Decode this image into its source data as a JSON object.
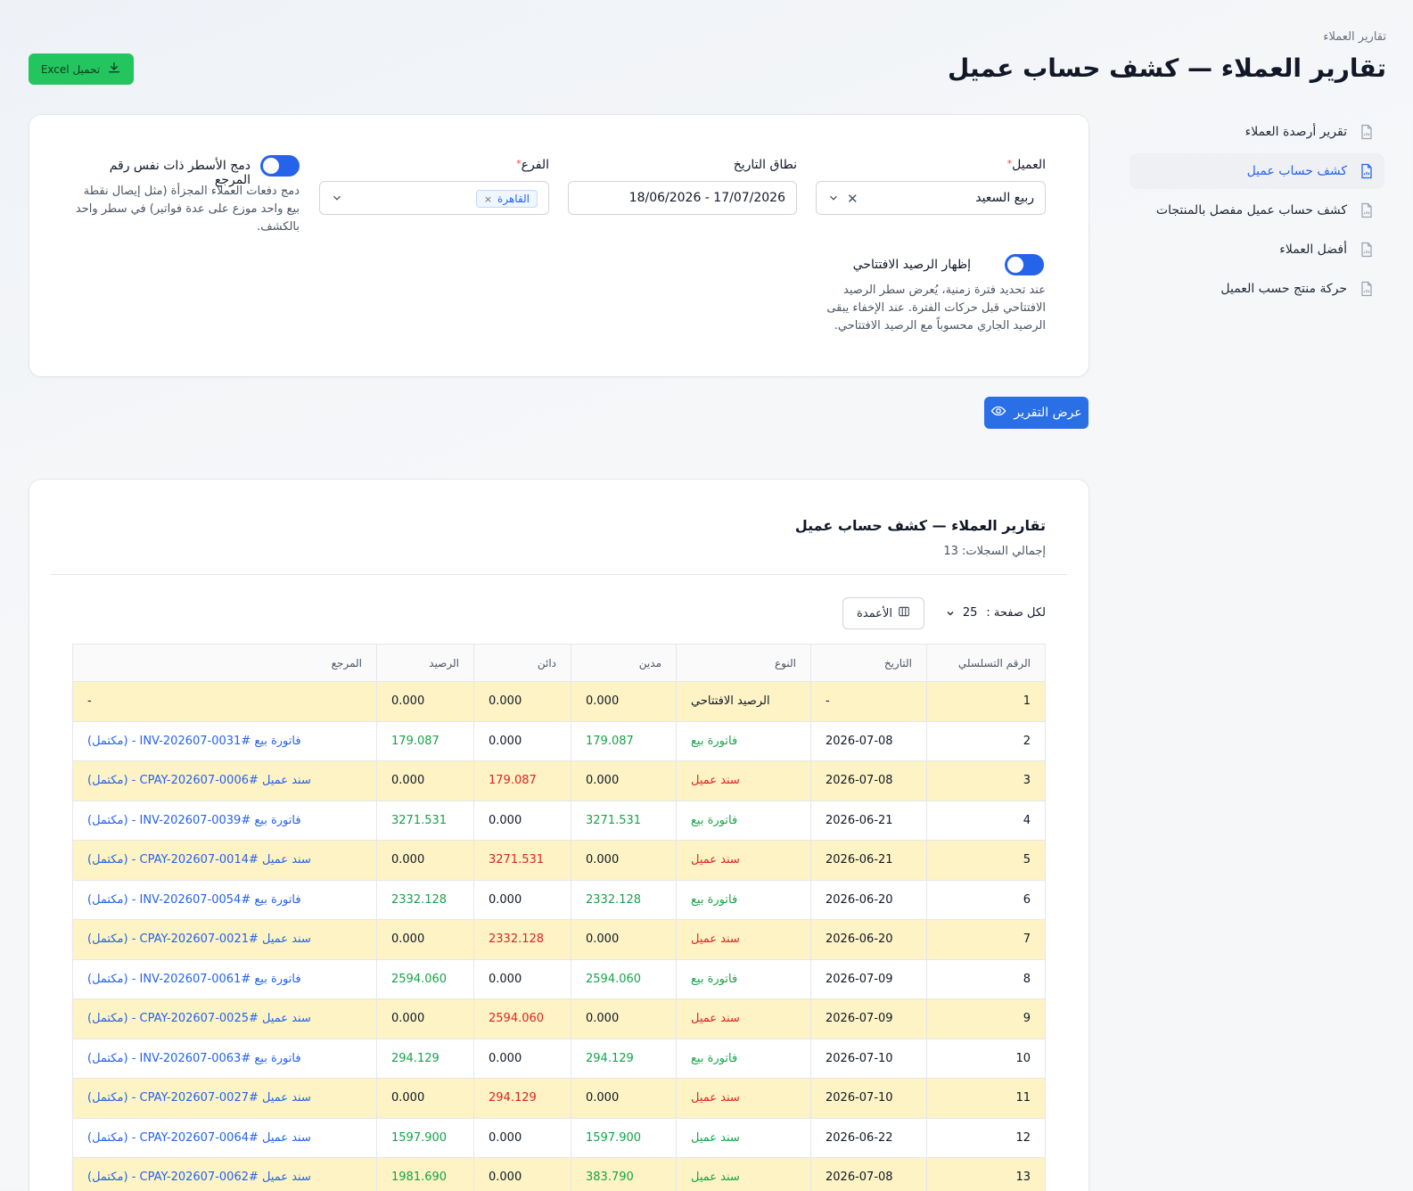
{
  "header": {
    "breadcrumb": "تقارير العملاء",
    "title": "تقارير العملاء — كشف حساب عميل",
    "excel_label": "تحميل Excel"
  },
  "sidebar": {
    "items": [
      {
        "label": "تقرير أرصدة العملاء",
        "active": false
      },
      {
        "label": "كشف حساب عميل",
        "active": true
      },
      {
        "label": "كشف حساب عميل مفصل بالمنتجات",
        "active": false
      },
      {
        "label": "أفضل العملاء",
        "active": false
      },
      {
        "label": "حركة منتج حسب العميل",
        "active": false
      }
    ]
  },
  "filters": {
    "customer_label": "العميل",
    "customer_value": "ربيع السعيد",
    "date_label": "نطاق التاريخ",
    "date_value": "18/06/2026 - 17/07/2026",
    "branch_label": "الفرع",
    "branch_tag": "القاهرة",
    "merge_label": "دمج الأسطر ذات نفس رقم المرجع",
    "merge_help": "دمج دفعات العملاء المجزأة (مثل إيصال نقطة بيع واحد موزع على عدة فواتير) في سطر واحد بالكشف.",
    "opening_label": "إظهار الرصيد الافتتاحي",
    "opening_help": "عند تحديد فترة زمنية، يُعرض سطر الرصيد الافتتاحي قبل حركات الفترة. عند الإخفاء يبقى الرصيد الجاري محسوباً مع الرصيد الافتتاحي."
  },
  "show_report_label": "عرض التقرير",
  "report": {
    "title": "تقارير العملاء — كشف حساب عميل",
    "total": "إجمالي السجلات: 13",
    "per_page_label": "لكل صفحة :",
    "per_page_value": "25",
    "columns_label": "الأعمدة",
    "headers": [
      "الرقم التسلسلي",
      "التاريخ",
      "النوع",
      "مدين",
      "دائن",
      "الرصيد",
      "المرجع"
    ],
    "rows": [
      {
        "serial": "1",
        "date": "-",
        "type": "الرصيد الافتتاحي",
        "type_color": "plain",
        "debit": "0.000",
        "credit": "0.000",
        "balance": "0.000",
        "ref": "-"
      },
      {
        "serial": "2",
        "date": "2026-07-08",
        "type": "فاتورة بيع",
        "type_color": "green",
        "debit": "179.087",
        "credit": "0.000",
        "balance": "179.087",
        "ref": "فاتورة بيع #INV-202607-0031 - (مكتمل)"
      },
      {
        "serial": "3",
        "date": "2026-07-08",
        "type": "سند عميل",
        "type_color": "red",
        "debit": "0.000",
        "credit": "179.087",
        "balance": "0.000",
        "ref": "سند عميل #CPAY-202607-0006 - (مكتمل)"
      },
      {
        "serial": "4",
        "date": "2026-06-21",
        "type": "فاتورة بيع",
        "type_color": "green",
        "debit": "3271.531",
        "credit": "0.000",
        "balance": "3271.531",
        "ref": "فاتورة بيع #INV-202607-0039 - (مكتمل)"
      },
      {
        "serial": "5",
        "date": "2026-06-21",
        "type": "سند عميل",
        "type_color": "red",
        "debit": "0.000",
        "credit": "3271.531",
        "balance": "0.000",
        "ref": "سند عميل #CPAY-202607-0014 - (مكتمل)"
      },
      {
        "serial": "6",
        "date": "2026-06-20",
        "type": "فاتورة بيع",
        "type_color": "green",
        "debit": "2332.128",
        "credit": "0.000",
        "balance": "2332.128",
        "ref": "فاتورة بيع #INV-202607-0054 - (مكتمل)"
      },
      {
        "serial": "7",
        "date": "2026-06-20",
        "type": "سند عميل",
        "type_color": "red",
        "debit": "0.000",
        "credit": "2332.128",
        "balance": "0.000",
        "ref": "سند عميل #CPAY-202607-0021 - (مكتمل)"
      },
      {
        "serial": "8",
        "date": "2026-07-09",
        "type": "فاتورة بيع",
        "type_color": "green",
        "debit": "2594.060",
        "credit": "0.000",
        "balance": "2594.060",
        "ref": "فاتورة بيع #INV-202607-0061 - (مكتمل)"
      },
      {
        "serial": "9",
        "date": "2026-07-09",
        "type": "سند عميل",
        "type_color": "red",
        "debit": "0.000",
        "credit": "2594.060",
        "balance": "0.000",
        "ref": "سند عميل #CPAY-202607-0025 - (مكتمل)"
      },
      {
        "serial": "10",
        "date": "2026-07-10",
        "type": "فاتورة بيع",
        "type_color": "green",
        "debit": "294.129",
        "credit": "0.000",
        "balance": "294.129",
        "ref": "فاتورة بيع #INV-202607-0063 - (مكتمل)"
      },
      {
        "serial": "11",
        "date": "2026-07-10",
        "type": "سند عميل",
        "type_color": "red",
        "debit": "0.000",
        "credit": "294.129",
        "balance": "0.000",
        "ref": "سند عميل #CPAY-202607-0027 - (مكتمل)"
      },
      {
        "serial": "12",
        "date": "2026-06-22",
        "type": "سند عميل",
        "type_color": "green",
        "debit": "1597.900",
        "credit": "0.000",
        "balance": "1597.900",
        "ref": "سند عميل #CPAY-202607-0064 - (مكتمل)"
      },
      {
        "serial": "13",
        "date": "2026-07-08",
        "type": "سند عميل",
        "type_color": "green",
        "debit": "383.790",
        "credit": "0.000",
        "balance": "1981.690",
        "ref": "سند عميل #CPAY-202607-0062 - (مكتمل)"
      }
    ]
  },
  "colors": {
    "accent": "#2563eb",
    "excel_button": "#22c55e",
    "row_highlight": "#fdf3c4",
    "positive": "#16a34a",
    "negative": "#dc2626"
  }
}
